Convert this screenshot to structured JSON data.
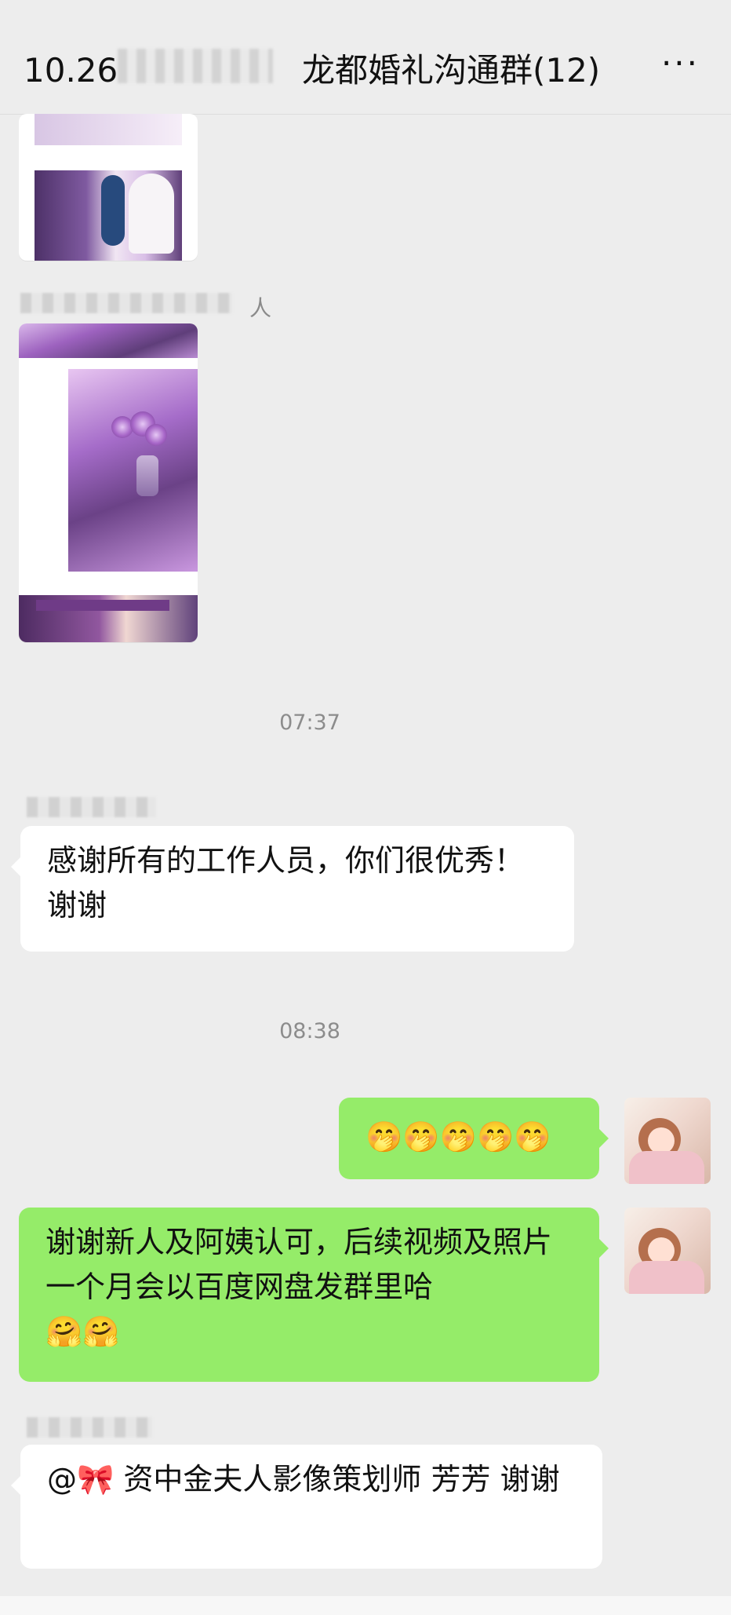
{
  "header": {
    "title": "10.26",
    "title_rest": "龙都婚礼沟通群(12)",
    "more": "···"
  },
  "messages": {
    "sender_tail": "人",
    "time_1": "07:37",
    "msg_1": "感谢所有的工作人员，你们很优秀！谢谢",
    "time_2": "08:38",
    "emoji_row": "🤭🤭🤭🤭🤭",
    "msg_2": "谢谢新人及阿姨认可，后续视频及照片一个月会以百度网盘发群里哈",
    "msg_2_emoji": "🤗🤗",
    "msg_3_prefix": "@🎀",
    "msg_3": "资中金夫人影像策划师 芳芳 谢谢"
  }
}
